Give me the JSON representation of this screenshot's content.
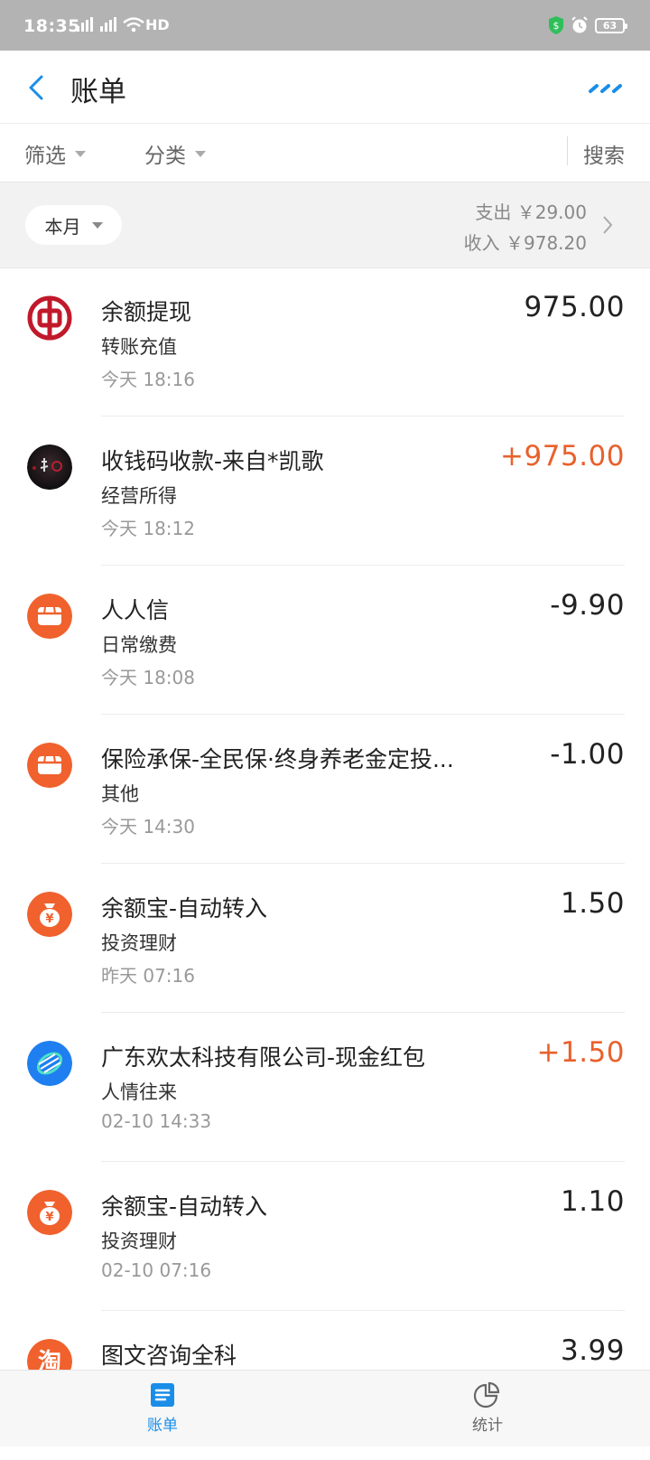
{
  "status_bar": {
    "time": "18:35",
    "network": "HD",
    "battery": "63",
    "icons": [
      "signal-icon",
      "signal-icon",
      "wifi-icon",
      "shield-icon",
      "alarm-icon",
      "battery-icon"
    ]
  },
  "nav": {
    "title": "账单",
    "back_icon": "chevron-left-icon",
    "more_icon": "more-dots-icon",
    "accent": "#1a8de8"
  },
  "filters": {
    "filter_label": "筛选",
    "category_label": "分类",
    "search_label": "搜索"
  },
  "summary": {
    "period": "本月",
    "expense": "支出 ￥29.00",
    "income": "收入 ￥978.20"
  },
  "transactions": [
    {
      "title": "余额提现",
      "category": "转账充值",
      "time": "今天  18:16",
      "amount": "975.00",
      "icon": "bank-of-china-icon",
      "type": "neutral"
    },
    {
      "title": "收钱码收款-来自*凯歌",
      "category": "经营所得",
      "time": "今天  18:12",
      "amount": "+975.00",
      "icon": "user-avatar",
      "type": "income"
    },
    {
      "title": "人人信",
      "category": "日常缴费",
      "time": "今天  18:08",
      "amount": "-9.90",
      "icon": "shop-icon",
      "type": "expense"
    },
    {
      "title": "保险承保-全民保·终身养老金定投...",
      "category": "其他",
      "time": "今天  14:30",
      "amount": "-1.00",
      "icon": "shop-icon",
      "type": "expense"
    },
    {
      "title": "余额宝-自动转入",
      "category": "投资理财",
      "time": "昨天  07:16",
      "amount": "1.50",
      "icon": "money-bag-icon",
      "type": "neutral"
    },
    {
      "title": "广东欢太科技有限公司-现金红包",
      "category": "人情往来",
      "time": "02-10  14:33",
      "amount": "+1.50",
      "icon": "heytap-logo-icon",
      "type": "income"
    },
    {
      "title": "余额宝-自动转入",
      "category": "投资理财",
      "time": "02-10  07:16",
      "amount": "1.10",
      "icon": "money-bag-icon",
      "type": "neutral"
    },
    {
      "title": "图文咨询全科",
      "category": "",
      "time": "",
      "amount": "3.99",
      "icon": "taobao-icon",
      "type": "neutral"
    }
  ],
  "tabbar": {
    "bill_label": "账单",
    "stats_label": "统计"
  },
  "colors": {
    "income": "#e8612c",
    "expense": "#222222",
    "brand_orange": "#f0612d",
    "statusbar": "#b3b3b3"
  }
}
